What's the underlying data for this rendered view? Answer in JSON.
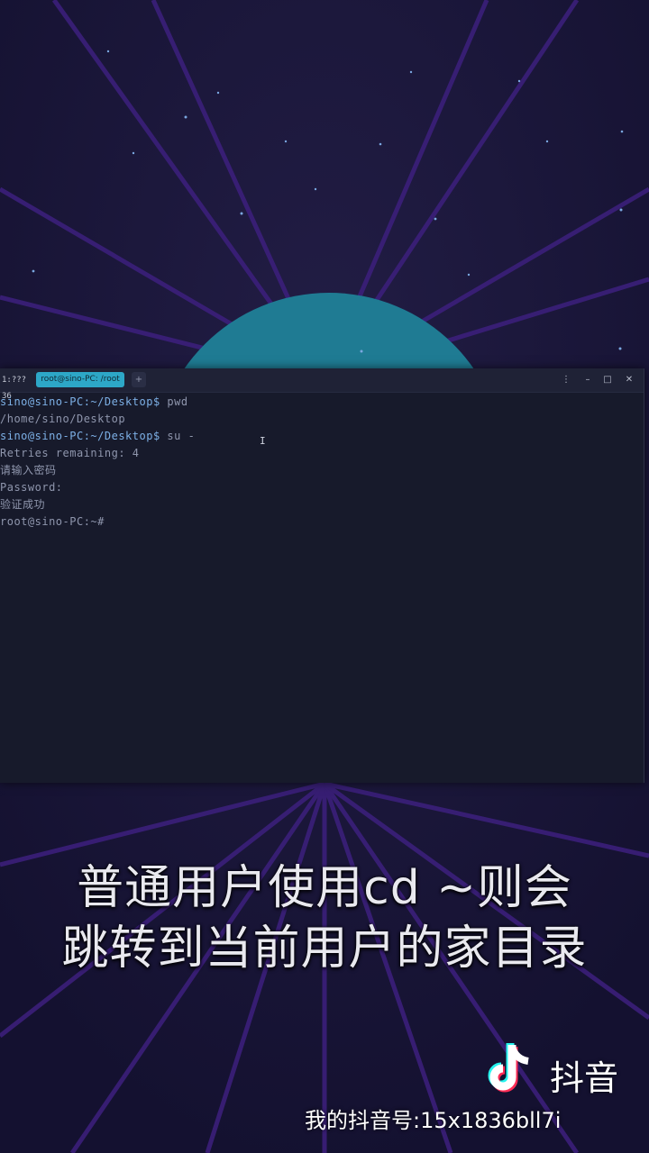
{
  "terminal": {
    "tab_inactive_label": "1:??? 36",
    "tab_active_label": "root@sino-PC: /root",
    "tab_add_label": "+",
    "window_buttons": {
      "menu": "⋮",
      "minimize": "–",
      "maximize": "□",
      "close": "✕"
    },
    "lines": [
      {
        "prompt": "sino@sino-PC:~/Desktop$",
        "text": " pwd"
      },
      {
        "prompt": "",
        "text": "/home/sino/Desktop"
      },
      {
        "prompt": "sino@sino-PC:~/Desktop$",
        "text": " su -"
      },
      {
        "prompt": "",
        "text": "Retries remaining: 4"
      },
      {
        "prompt": "",
        "text": "请输入密码"
      },
      {
        "prompt": "",
        "text": "Password:"
      },
      {
        "prompt": "",
        "text": "验证成功"
      },
      {
        "prompt": "",
        "text": "root@sino-PC:~#"
      }
    ],
    "ibeam": "I"
  },
  "subtitle": {
    "line1": "普通用户使用cd ~则会",
    "line2": "跳转到当前用户的家目录"
  },
  "watermark": {
    "brand": "抖音",
    "account": "我的抖音号:15x1836bll7i"
  },
  "colors": {
    "planet": "#1f7b93",
    "sky": "#1a1534",
    "ray": "#3a1f78",
    "tab_active": "#2da7c7"
  }
}
